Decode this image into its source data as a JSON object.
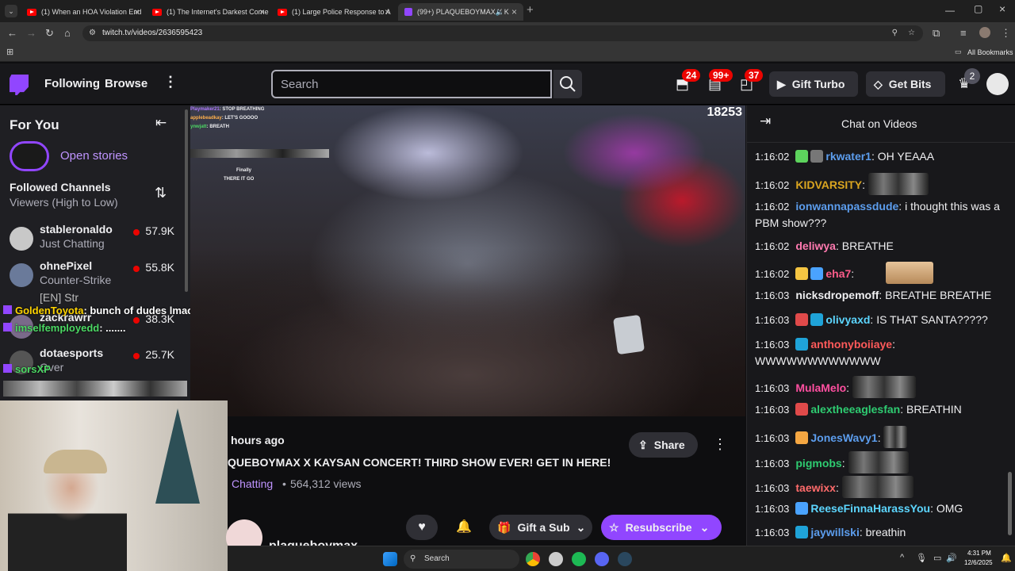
{
  "browser": {
    "tabs": [
      {
        "title": "(1) When an HOA Violation End"
      },
      {
        "title": "(1) The Internet's Darkest Corne"
      },
      {
        "title": "(1) Large Police Response to A"
      },
      {
        "title": "(99+) PLAQUEBOYMAX X K"
      }
    ],
    "url": "twitch.tv/videos/2636595423",
    "bookmarks_label": "All Bookmarks"
  },
  "topnav": {
    "following": "Following",
    "browse": "Browse",
    "search_placeholder": "Search",
    "badge_activity": "24",
    "badge_inbox": "99+",
    "badge_notifications": "37",
    "gift_turbo": "Gift Turbo",
    "get_bits": "Get Bits",
    "prime_badge": "2"
  },
  "sidebar": {
    "for_you": "For You",
    "open_stories": "Open stories",
    "followed_channels": "Followed Channels",
    "sort": "Viewers (High to Low)",
    "channels": [
      {
        "name": "stableronaldo",
        "game": "Just Chatting",
        "viewers": "57.9K"
      },
      {
        "name": "ohnePixel",
        "game": "Counter-Strike",
        "viewers": "55.8K"
      },
      {
        "name": "zackrawrr",
        "game": "[EN] Str",
        "viewers": "38.3K"
      },
      {
        "name": "dotaesports",
        "game": "Over",
        "viewers": "25.7K"
      }
    ]
  },
  "overlay_chat": [
    {
      "user": "GoldenToyota",
      "text": "bunch of dudes lmao"
    },
    {
      "user": "imselfemployedd",
      "text": "......."
    },
    {
      "user": "sorsXP",
      "text": ""
    }
  ],
  "stream_overlay_chat": [
    {
      "user": "Playmaker21",
      "text": "STOP BREATHING"
    },
    {
      "user": "applebeadkay",
      "text": "LET'S GOOOO"
    },
    {
      "user": "ynwjatt",
      "text": "BREATH"
    },
    {
      "user": "",
      "text": "Finally"
    },
    {
      "user": "",
      "text": "THERE IT GO"
    }
  ],
  "video": {
    "viewer_count": "18253"
  },
  "info": {
    "time_ago": "hours ago",
    "title": "QUEBOYMAX X KAYSAN CONCERT! THIRD SHOW EVER! GET IN HERE!",
    "category": "Chatting",
    "views": "564,312 views",
    "share": "Share",
    "gift_sub": "Gift a Sub",
    "resubscribe": "Resubscribe",
    "channel_name": "plaqueboymax"
  },
  "chat": {
    "header": "Chat on Videos",
    "messages": [
      {
        "time": "1:16:02",
        "user": "rkwater1",
        "color": "#5c9ded",
        "text": "OH YEAAA"
      },
      {
        "time": "1:16:02",
        "user": "KIDVARSITY",
        "color": "#daa520",
        "text": ""
      },
      {
        "time": "1:16:02",
        "user": "ionwannapassdude",
        "color": "#5c9ded",
        "text": "i thought this was a PBM show???"
      },
      {
        "time": "1:16:02",
        "user": "deliwya",
        "color": "#ff7ab0",
        "text": "BREATHE"
      },
      {
        "time": "1:16:02",
        "user": "eha7",
        "color": "#ff5c8a",
        "text": ""
      },
      {
        "time": "1:16:03",
        "user": "nicksdropemoff",
        "color": "#efeff1",
        "text": "BREATHE BREATHE"
      },
      {
        "time": "1:16:03",
        "user": "olivyaxd",
        "color": "#5cd6ff",
        "text": "IS THAT SANTA?????"
      },
      {
        "time": "1:16:03",
        "user": "anthonyboiiaye",
        "color": "#ff5a5a",
        "text": "WWWWWWWWWWWW"
      },
      {
        "time": "1:16:03",
        "user": "MulaMelo",
        "color": "#ff4fa0",
        "text": ""
      },
      {
        "time": "1:16:03",
        "user": "alextheeaglesfan",
        "color": "#2ecc71",
        "text": "BREATHIN"
      },
      {
        "time": "1:16:03",
        "user": "JonesWavy1",
        "color": "#5c9ded",
        "text": ""
      },
      {
        "time": "1:16:03",
        "user": "pigmobs",
        "color": "#2ecc71",
        "text": ""
      },
      {
        "time": "1:16:03",
        "user": "taewixx",
        "color": "#ff6b6b",
        "text": ""
      },
      {
        "time": "1:16:03",
        "user": "ReeseFinnaHarassYou",
        "color": "#5cd6ff",
        "text": "OMG"
      },
      {
        "time": "1:16:03",
        "user": "jaywillski",
        "color": "#5c9ded",
        "text": "breathin"
      }
    ]
  },
  "taskbar": {
    "search": "Search",
    "time": "4:31 PM",
    "date": "12/6/2025"
  }
}
